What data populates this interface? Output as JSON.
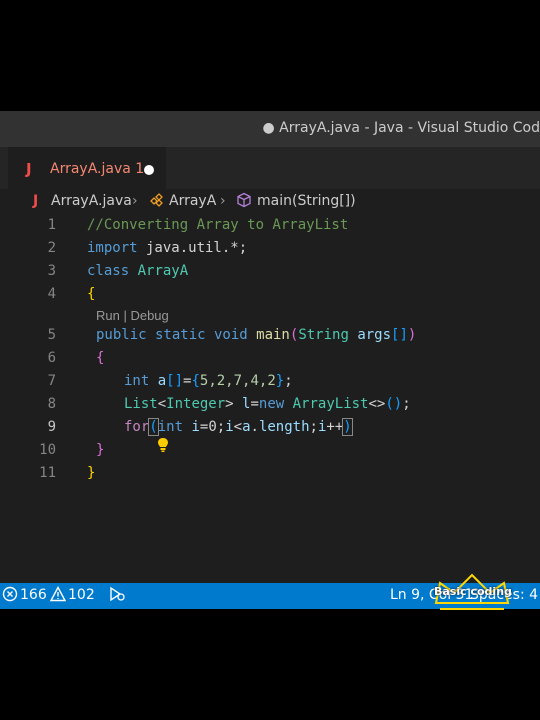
{
  "window": {
    "title": "● ArrayA.java - Java - Visual Studio Cod"
  },
  "tab": {
    "icon": "J",
    "label": "ArrayA.java",
    "problems": "1"
  },
  "breadcrumb": {
    "file_icon": "J",
    "file": "ArrayA.java",
    "class": "ArrayA",
    "method": "main(String[])"
  },
  "codelens": "Run | Debug",
  "line_numbers": [
    "1",
    "2",
    "3",
    "4",
    "5",
    "6",
    "7",
    "8",
    "9",
    "10",
    "11"
  ],
  "code": {
    "l1": "//Converting Array to ArrayList",
    "l2_kw": "import",
    "l2_rest": " java.util.*;",
    "l3_kw": "class",
    "l3_name": " ArrayA",
    "l4": "{",
    "l5_kw": "public static void",
    "l5_fn": " main",
    "l5_p1": "(",
    "l5_type": "String",
    "l5_arg": " args",
    "l5_p2": "[]",
    "l5_p3": ")",
    "l6": "{",
    "l7_kw": "int",
    "l7_var": " a",
    "l7_b": "[]",
    "l7_eq": "=",
    "l7_ob": "{",
    "l7_nums": "5,2,7,4,2",
    "l7_cb": "}",
    "l7_end": ";",
    "l8_type": "List",
    "l8_lt": "<",
    "l8_gen": "Integer",
    "l8_gt": ">",
    "l8_var": " l",
    "l8_eq": "=",
    "l8_new": "new",
    "l8_cls": " ArrayList",
    "l8_diamond": "<>",
    "l8_paren": "()",
    "l8_end": ";",
    "l9_ctl": "for",
    "l9_op": "(",
    "l9_kw": "int",
    "l9_i": " i",
    "l9_init": "=0;",
    "l9_i2": "i",
    "l9_lt": "<",
    "l9_a": "a",
    "l9_dot": ".",
    "l9_len": "length",
    "l9_semi": ";",
    "l9_i3": "i",
    "l9_inc": "++",
    "l9_cp": ")",
    "l10": "}",
    "l11": "}"
  },
  "status": {
    "errors": "166",
    "warnings": "102",
    "position": "Ln 9, Col 31",
    "spaces": "Spaces: 4"
  },
  "watermark": "Basic coding",
  "colors": {
    "accent": "#007acc",
    "editor_bg": "#1e1e1e",
    "error": "#f14c4c"
  }
}
